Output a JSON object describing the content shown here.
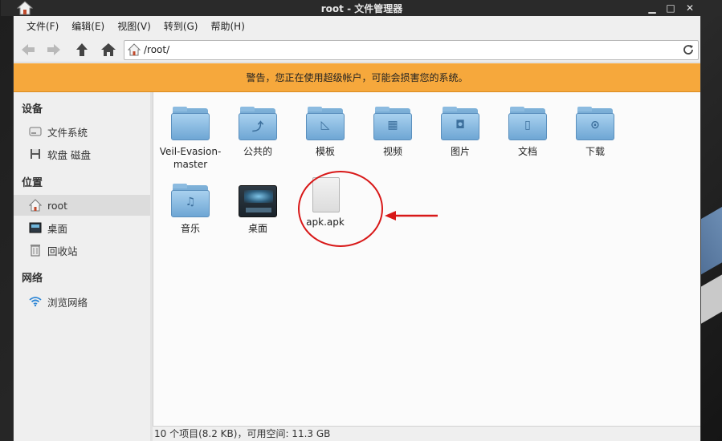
{
  "window": {
    "title": "root - 文件管理器"
  },
  "menu": [
    "文件(F)",
    "编辑(E)",
    "视图(V)",
    "转到(G)",
    "帮助(H)"
  ],
  "location": {
    "path": "/root/"
  },
  "warning": {
    "text": "警告，您正在使用超级帐户，可能会损害您的系统。"
  },
  "sidebar": {
    "devices_heading": "设备",
    "devices": [
      {
        "label": "文件系统",
        "icon": "drive-icon"
      },
      {
        "label": "软盘 磁盘",
        "icon": "floppy-icon"
      }
    ],
    "places_heading": "位置",
    "places": [
      {
        "label": "root",
        "icon": "home-icon",
        "active": true
      },
      {
        "label": "桌面",
        "icon": "desktop-icon"
      },
      {
        "label": "回收站",
        "icon": "trash-icon"
      }
    ],
    "network_heading": "网络",
    "network": [
      {
        "label": "浏览网络",
        "icon": "wifi-icon"
      }
    ]
  },
  "files": [
    {
      "label": "Veil-Evasion-master",
      "type": "folder",
      "emblem": ""
    },
    {
      "label": "公共的",
      "type": "folder",
      "emblem": "share"
    },
    {
      "label": "模板",
      "type": "folder",
      "emblem": "template"
    },
    {
      "label": "视频",
      "type": "folder",
      "emblem": "video"
    },
    {
      "label": "图片",
      "type": "folder",
      "emblem": "picture"
    },
    {
      "label": "文档",
      "type": "folder",
      "emblem": "document"
    },
    {
      "label": "下载",
      "type": "folder",
      "emblem": "download"
    },
    {
      "label": "音乐",
      "type": "folder",
      "emblem": "music"
    },
    {
      "label": "桌面",
      "type": "desktop",
      "emblem": ""
    },
    {
      "label": "apk.apk",
      "type": "file",
      "emblem": ""
    }
  ],
  "status": {
    "text": "10 个项目(8.2 KB)，可用空间: 11.3 GB"
  },
  "colors": {
    "warning_bg": "#f6a83c",
    "annotation": "#d81818"
  }
}
